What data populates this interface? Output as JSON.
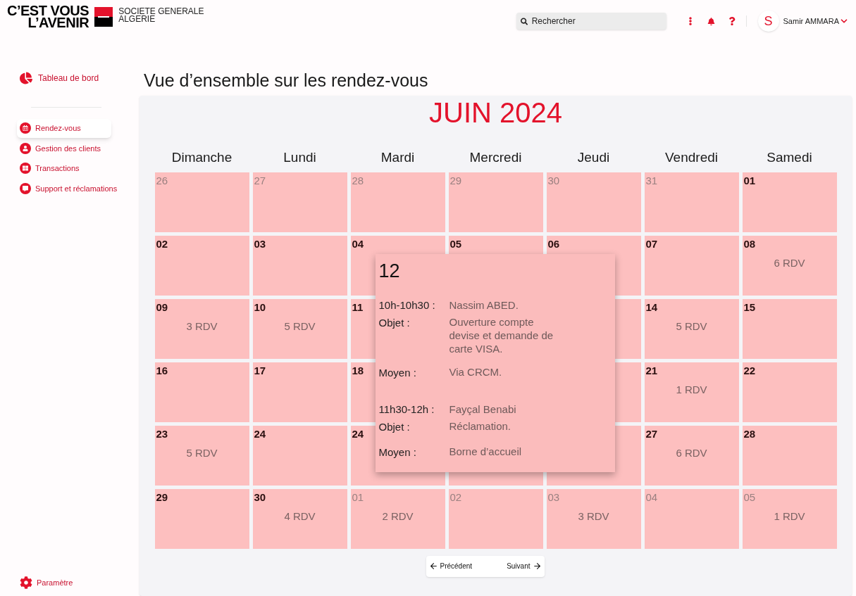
{
  "logo": {
    "slogan_line1": "C’EST VOUS",
    "slogan_line2": "L’AVENIR",
    "brand_line1": "SOCIETE GENERALE",
    "brand_line2": "ALGERIE"
  },
  "search": {
    "placeholder": "Rechercher"
  },
  "user": {
    "initial": "S",
    "name": "Samir AMMARA"
  },
  "sidebar": {
    "top_item": {
      "label": "Tableau de bord",
      "selected": false
    },
    "items": [
      {
        "label": "Rendez-vous",
        "selected": true,
        "kind": "calendar"
      },
      {
        "label": "Gestion des clients",
        "selected": false,
        "kind": "user"
      },
      {
        "label": "Transactions",
        "selected": false,
        "kind": "grid"
      },
      {
        "label": "Support et réclamations",
        "selected": false,
        "kind": "support"
      }
    ],
    "bottom_item": {
      "label": "Paramètre",
      "selected": false
    }
  },
  "page_title": "Vue d’ensemble sur les rendez-vous",
  "calendar": {
    "month": "JUIN 2024",
    "weekdays": [
      "Dimanche",
      "Lundi",
      "Mardi",
      "Mercredi",
      "Jeudi",
      "Vendredi",
      "Samedi"
    ],
    "weeks": [
      [
        {
          "day": "26",
          "outside": true
        },
        {
          "day": "27",
          "outside": true
        },
        {
          "day": "28",
          "outside": true
        },
        {
          "day": "29",
          "outside": true
        },
        {
          "day": "30",
          "outside": true
        },
        {
          "day": "31",
          "outside": true
        },
        {
          "day": "01",
          "outside": false
        }
      ],
      [
        {
          "day": "02",
          "outside": false
        },
        {
          "day": "03",
          "outside": false
        },
        {
          "day": "04",
          "outside": false
        },
        {
          "day": "05",
          "outside": false
        },
        {
          "day": "06",
          "outside": false
        },
        {
          "day": "07",
          "outside": false
        },
        {
          "day": "08",
          "outside": false,
          "count": "6 RDV"
        }
      ],
      [
        {
          "day": "09",
          "outside": false,
          "count": "3 RDV"
        },
        {
          "day": "10",
          "outside": false,
          "count": "5 RDV"
        },
        {
          "day": "11",
          "outside": false
        },
        {
          "day": "14",
          "outside": false,
          "count": "5 RDV"
        },
        {
          "day": "15",
          "outside": false
        }
      ],
      [
        {
          "day": "16",
          "outside": false
        },
        {
          "day": "17",
          "outside": false
        },
        {
          "day": "18",
          "outside": false
        },
        {
          "day": "21",
          "outside": false,
          "count": "1 RDV"
        },
        {
          "day": "22",
          "outside": false
        }
      ],
      [
        {
          "day": "23",
          "outside": false,
          "count": "5 RDV"
        },
        {
          "day": "24",
          "outside": false
        },
        {
          "day": "24",
          "outside": false
        },
        {
          "day": "27",
          "outside": false,
          "count": "6 RDV"
        },
        {
          "day": "28",
          "outside": false
        }
      ],
      [
        {
          "day": "29",
          "outside": false
        },
        {
          "day": "30",
          "outside": false,
          "count": "4 RDV"
        },
        {
          "day": "01",
          "outside": true,
          "count": "2 RDV"
        },
        {
          "day": "02",
          "outside": true
        },
        {
          "day": "03",
          "outside": true,
          "count": "3 RDV"
        },
        {
          "day": "04",
          "outside": true
        },
        {
          "day": "05",
          "outside": true,
          "count": "1 RDV"
        }
      ]
    ],
    "popup": {
      "day": "12",
      "appointments": [
        {
          "time": "10h-10h30 :",
          "name": "Nassim ABED.",
          "rows": [
            {
              "label": "Objet :",
              "value": "Ouverture compte devise et demande de carte VISA."
            },
            {
              "label": "Moyen :",
              "value": "Via CRCM."
            }
          ]
        },
        {
          "time": "11h30-12h :",
          "name": "Fayçal Benabi",
          "rows": [
            {
              "label": "Objet :",
              "value": "Réclamation."
            },
            {
              "label": "Moyen :",
              "value": "Borne d’accueil"
            }
          ]
        }
      ]
    },
    "prev": "Précédent",
    "next": "Suivant"
  }
}
